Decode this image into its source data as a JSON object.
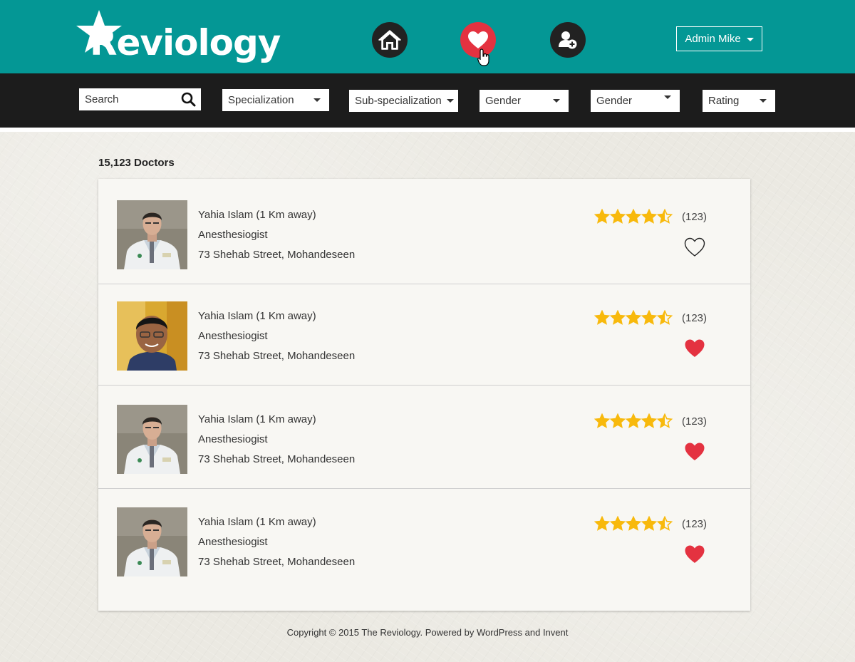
{
  "brand": {
    "logo_text": "Reviology"
  },
  "header": {
    "nav": [
      "home-icon",
      "heart-icon",
      "add-user-icon"
    ],
    "admin_label": "Admin Mike"
  },
  "filters": {
    "search_placeholder": "Search",
    "specialization": "Specialization",
    "sub_specialization": "Sub-specialization",
    "gender1": "Gender",
    "gender2": "Gender",
    "rating": "Rating"
  },
  "results": {
    "count_label": "15,123 Doctors",
    "doctors": [
      {
        "name": "Yahia Islam (1 Km away)",
        "specialty": "Anesthesiogist",
        "address": "73 Shehab Street, Mohandeseen",
        "rating": 4.5,
        "reviews": "(123)",
        "favorite": false
      },
      {
        "name": "Yahia Islam (1 Km away)",
        "specialty": "Anesthesiogist",
        "address": "73 Shehab Street, Mohandeseen",
        "rating": 4.5,
        "reviews": "(123)",
        "favorite": true
      },
      {
        "name": "Yahia Islam (1 Km away)",
        "specialty": "Anesthesiogist",
        "address": "73 Shehab Street, Mohandeseen",
        "rating": 4.5,
        "reviews": "(123)",
        "favorite": true
      },
      {
        "name": "Yahia Islam (1 Km away)",
        "specialty": "Anesthesiogist",
        "address": "73 Shehab Street, Mohandeseen",
        "rating": 4.5,
        "reviews": "(123)",
        "favorite": true
      }
    ]
  },
  "footer": {
    "text": "Copyright © 2015 The Reviology. Powered by WordPress and Invent"
  },
  "colors": {
    "teal": "#049795",
    "dark": "#1c1c1c",
    "accent_red": "#e43240",
    "star": "#f8b90c"
  }
}
